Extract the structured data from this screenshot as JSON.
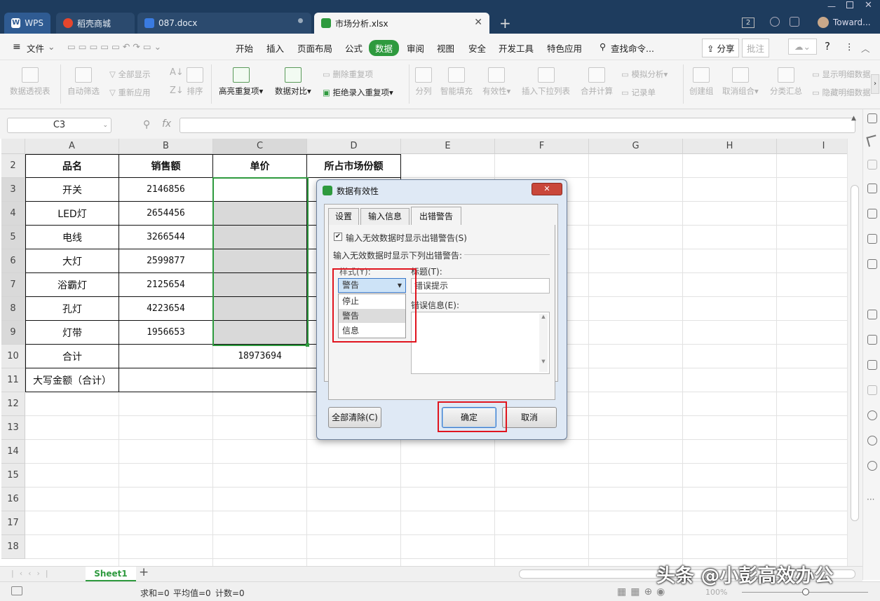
{
  "tabs": [
    {
      "label": "WPS",
      "icon": "wps-logo-icon"
    },
    {
      "label": "稻壳商城",
      "icon": "docer-flame-icon"
    },
    {
      "label": "087.docx",
      "icon": "writer-doc-icon"
    },
    {
      "label": "市场分析.xlsx",
      "icon": "spreadsheet-icon"
    }
  ],
  "titlebar": {
    "user": "Toward...",
    "badge": "2"
  },
  "menu": {
    "file": "文件",
    "items": [
      "开始",
      "插入",
      "页面布局",
      "公式",
      "数据",
      "审阅",
      "视图",
      "安全",
      "开发工具",
      "特色应用"
    ],
    "active": "数据",
    "search": "查找命令...",
    "share": "分享",
    "comment": "批注"
  },
  "ribbon": {
    "pivot": "数据透视表",
    "autofilter": "自动筛选",
    "show_all": "全部显示",
    "reapply": "重新应用",
    "sort": "排序",
    "highlight_dup": "高亮重复项",
    "compare": "数据对比",
    "remove_dup": "删除重复项",
    "reject_dup": "拒绝录入重复项",
    "split": "分列",
    "fill": "智能填充",
    "validity": "有效性",
    "dropdown": "插入下拉列表",
    "consolidate": "合并计算",
    "simulate": "模拟分析",
    "record": "记录单",
    "group": "创建组",
    "ungroup": "取消组合",
    "subtotal": "分类汇总",
    "show_detail": "显示明细数据",
    "hide_detail": "隐藏明细数据"
  },
  "formula": {
    "cell_ref": "C3",
    "fx": "fx"
  },
  "columns": [
    "A",
    "B",
    "C",
    "D",
    "E",
    "F",
    "G",
    "H",
    "I"
  ],
  "rows": [
    "2",
    "3",
    "4",
    "5",
    "6",
    "7",
    "8",
    "9",
    "10",
    "11",
    "12",
    "13",
    "14",
    "15",
    "16",
    "17",
    "18"
  ],
  "table": {
    "headers": [
      "品名",
      "销售额",
      "单价",
      "所占市场份额"
    ],
    "rows": [
      [
        "开关",
        "2146856"
      ],
      [
        "LED灯",
        "2654456"
      ],
      [
        "电线",
        "3266544"
      ],
      [
        "大灯",
        "2599877"
      ],
      [
        "浴霸灯",
        "2125654"
      ],
      [
        "孔灯",
        "4223654"
      ],
      [
        "灯带",
        "1956653"
      ]
    ],
    "total_label": "合计",
    "total_value": "18973694",
    "capital_label": "大写金额（合计）"
  },
  "dialog": {
    "title": "数据有效性",
    "tabs": [
      "设置",
      "输入信息",
      "出错警告"
    ],
    "active_tab": "出错警告",
    "checkbox_label": "输入无效数据时显示出错警告(S)",
    "checkbox_checked": true,
    "section_label": "输入无效数据时显示下列出错警告:",
    "style_label": "样式(Y):",
    "style_value": "警告",
    "style_options": [
      "停止",
      "警告",
      "信息"
    ],
    "title_label": "标题(T):",
    "title_value": "错误提示",
    "message_label": "错误信息(E):",
    "clear_all": "全部清除(C)",
    "ok": "确定",
    "cancel": "取消"
  },
  "sheets": {
    "active": "Sheet1"
  },
  "status": {
    "sum": "求和=0",
    "avg": "平均值=0",
    "count": "计数=0",
    "zoom": "100%"
  },
  "watermark": "头条 @小彭高效办公",
  "colors": {
    "titlebar": "#1e3c5e",
    "accent_green": "#2e9a3e",
    "highlight_red": "#e0141e",
    "selection_fill": "#d9d9d9"
  }
}
